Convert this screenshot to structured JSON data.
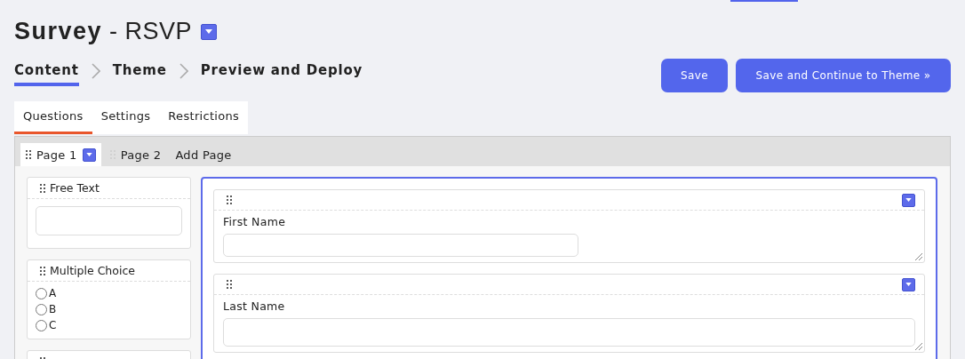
{
  "title": "**Survey** - RSVP",
  "steps": [
    {
      "label": "Content",
      "selected": true
    },
    {
      "label": "Theme",
      "selected": false
    },
    {
      "label": "Preview and Deploy",
      "selected": false
    }
  ],
  "buttons": [
    "Save",
    "Save and Continue to Theme »"
  ],
  "tabs": [
    {
      "label": "Questions",
      "selected": true
    },
    {
      "label": "Settings",
      "selected": false
    },
    {
      "label": "Restrictions",
      "selected": false
    }
  ],
  "pages": [
    {
      "label": "Page 1",
      "selected": true
    },
    {
      "label": "Page 2",
      "selected": false
    }
  ],
  "add_page": "Add Page",
  "palette": [
    {
      "kind": "text",
      "label": "Free Text"
    },
    {
      "kind": "choice",
      "label": "Multiple Choice",
      "options": [
        {
          "label": "A",
          "checked": false
        },
        {
          "label": "B",
          "checked": false
        },
        {
          "label": "C",
          "checked": false
        }
      ]
    },
    {
      "kind": "blank"
    }
  ],
  "questions": [
    {
      "label": "First Name",
      "wide": false
    },
    {
      "label": "Last Name",
      "wide": true
    }
  ]
}
